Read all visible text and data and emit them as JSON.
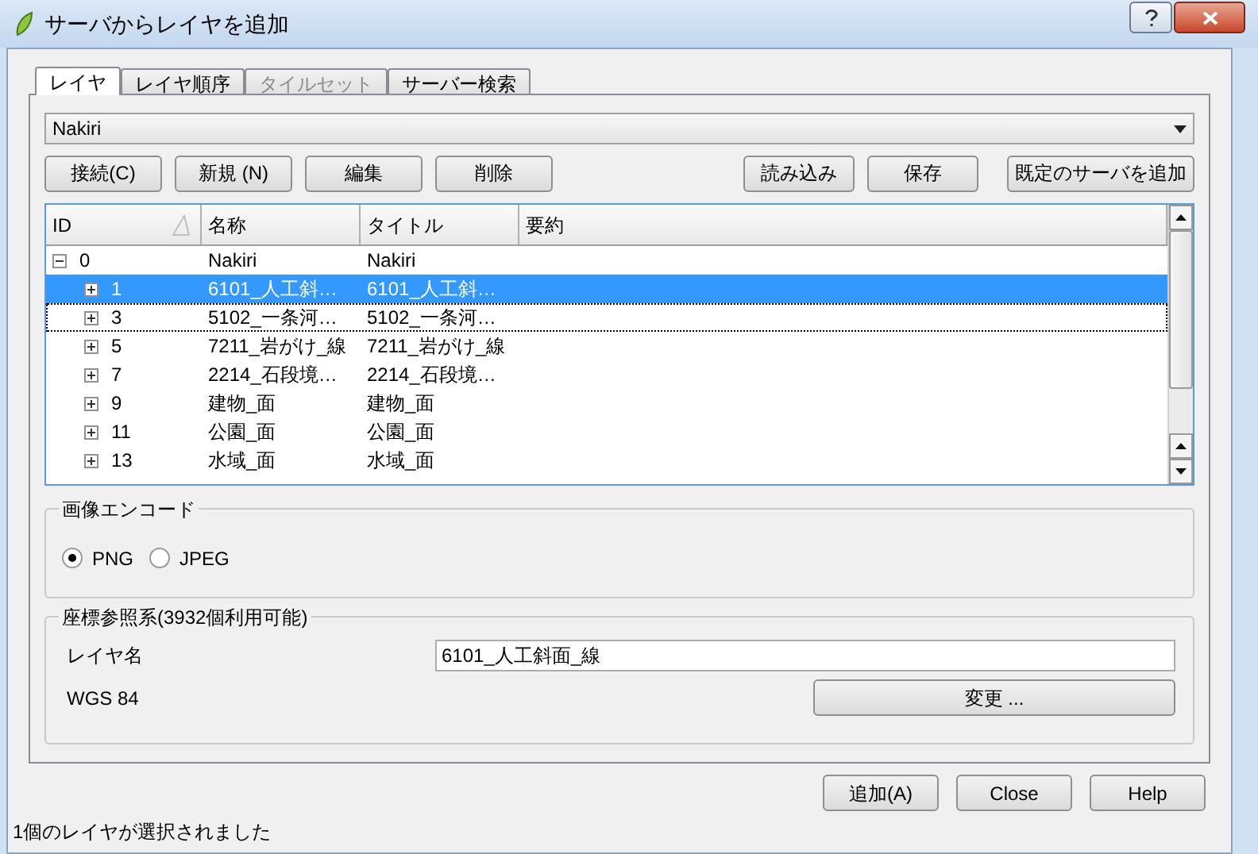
{
  "window": {
    "title": "サーバからレイヤを追加"
  },
  "tabs": [
    {
      "label": "レイヤ",
      "selected": true,
      "disabled": false
    },
    {
      "label": "レイヤ順序",
      "selected": false,
      "disabled": false
    },
    {
      "label": "タイルセット",
      "selected": false,
      "disabled": true
    },
    {
      "label": "サーバー検索",
      "selected": false,
      "disabled": false
    }
  ],
  "connection": {
    "value": "Nakiri"
  },
  "left_buttons": [
    "接続(C)",
    "新規 (N)",
    "編集",
    "削除"
  ],
  "right_buttons": [
    "読み込み",
    "保存",
    "既定のサーバを追加"
  ],
  "table": {
    "columns": [
      "ID",
      "名称",
      "タイトル",
      "要約"
    ],
    "rows": [
      {
        "id": "0",
        "name": "Nakiri",
        "title": "Nakiri",
        "expanded": true,
        "selected": false,
        "focused": false,
        "children": [
          {
            "id": "1",
            "name": "6101_人工斜…",
            "title": "6101_人工斜…",
            "expanded": false,
            "selected": true,
            "focused": false
          },
          {
            "id": "3",
            "name": "5102_一条河…",
            "title": "5102_一条河…",
            "expanded": false,
            "selected": false,
            "focused": true
          },
          {
            "id": "5",
            "name": "7211_岩がけ_線",
            "title": "7211_岩がけ_線",
            "expanded": false,
            "selected": false,
            "focused": false
          },
          {
            "id": "7",
            "name": "2214_石段境…",
            "title": "2214_石段境…",
            "expanded": false,
            "selected": false,
            "focused": false
          },
          {
            "id": "9",
            "name": "建物_面",
            "title": "建物_面",
            "expanded": false,
            "selected": false,
            "focused": false
          },
          {
            "id": "11",
            "name": "公園_面",
            "title": "公園_面",
            "expanded": false,
            "selected": false,
            "focused": false
          },
          {
            "id": "13",
            "name": "水域_面",
            "title": "水域_面",
            "expanded": false,
            "selected": false,
            "focused": false
          }
        ]
      }
    ]
  },
  "image_encoding": {
    "title": "画像エンコード",
    "options": [
      {
        "label": "PNG",
        "selected": true
      },
      {
        "label": "JPEG",
        "selected": false
      }
    ]
  },
  "crs": {
    "title": "座標参照系(3932個利用可能)",
    "layer_name_label": "レイヤ名",
    "layer_name_value": "6101_人工斜面_線",
    "crs_name": "WGS 84",
    "change_button": "変更 ..."
  },
  "footer_buttons": [
    "追加(A)",
    "Close",
    "Help"
  ],
  "status_bar": "1個のレイヤが選択されました"
}
